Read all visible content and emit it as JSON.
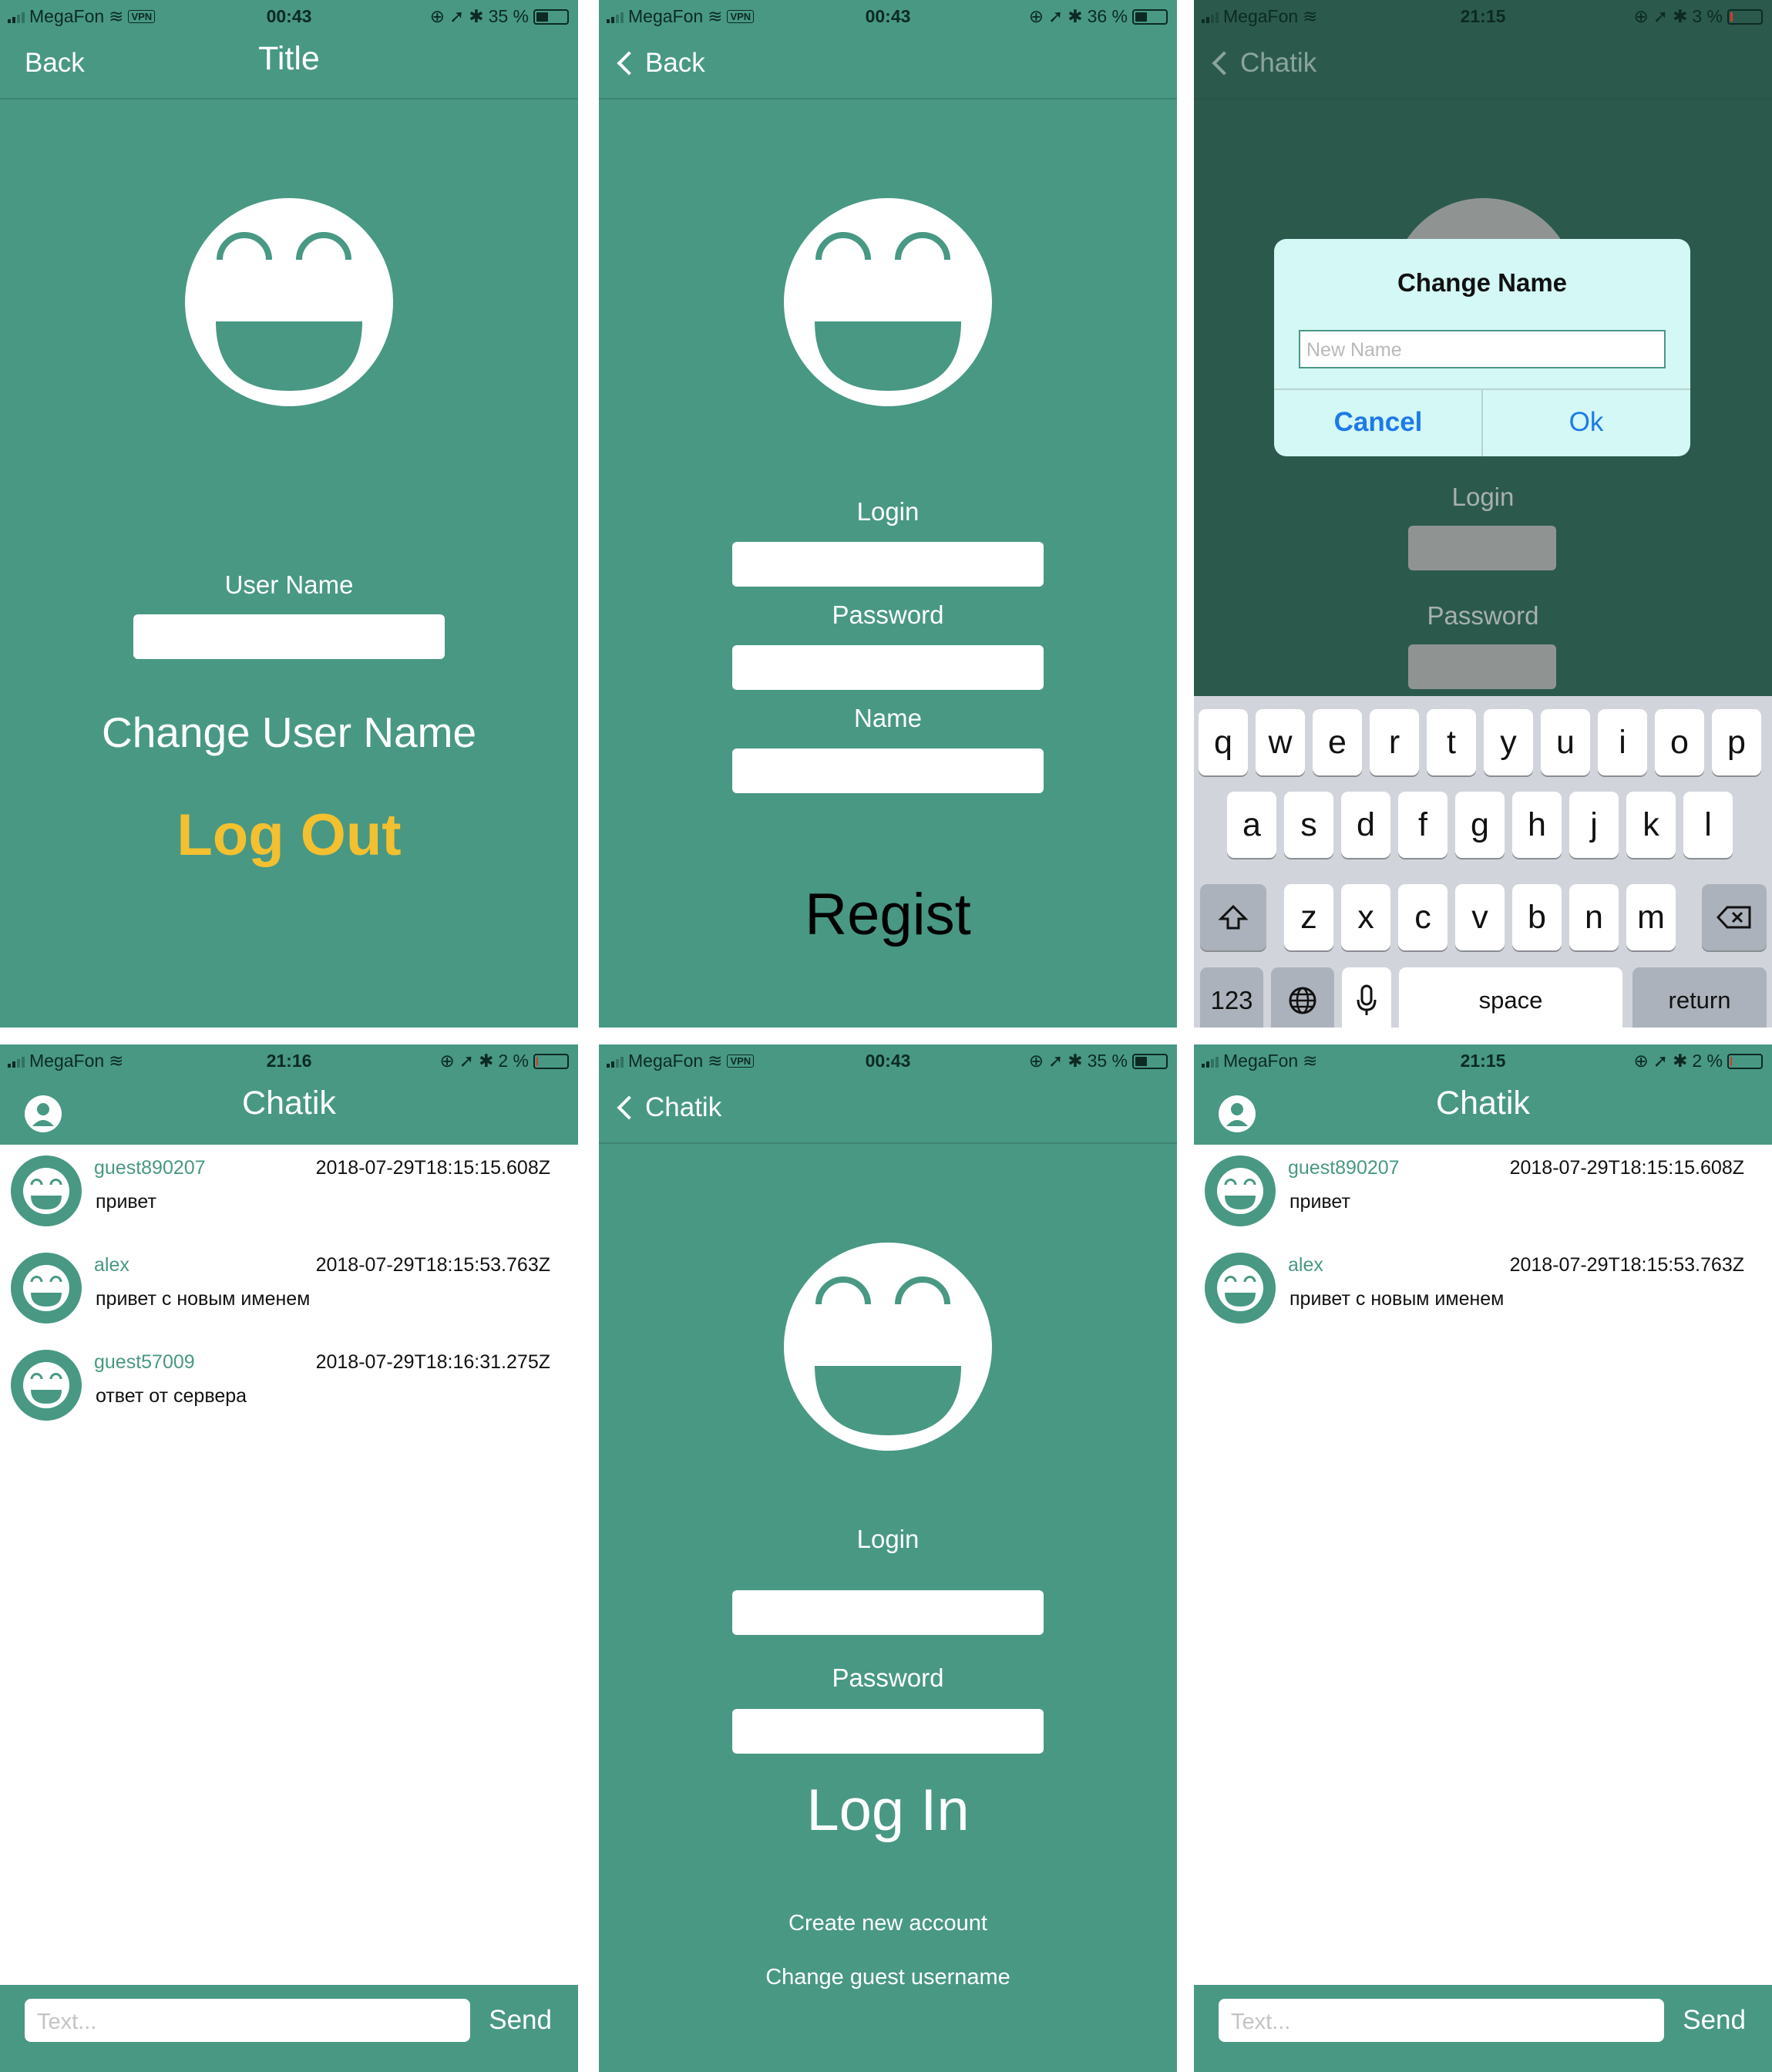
{
  "status_bars": [
    {
      "carrier": "MegaFon",
      "time": "00:43",
      "battery": "35 %",
      "vpn": "VPN",
      "battery_level": 0.35
    },
    {
      "carrier": "MegaFon",
      "time": "00:43",
      "battery": "36 %",
      "vpn": "VPN",
      "battery_level": 0.36
    },
    {
      "carrier": "MegaFon",
      "time": "21:15",
      "battery": "3 %",
      "battery_level": 0.03
    },
    {
      "carrier": "MegaFon",
      "time": "21:16",
      "battery": "2 %",
      "battery_level": 0.02
    },
    {
      "carrier": "MegaFon",
      "time": "00:43",
      "battery": "35 %",
      "vpn": "VPN",
      "battery_level": 0.35
    },
    {
      "carrier": "MegaFon",
      "time": "21:15",
      "battery": "2 %",
      "battery_level": 0.02
    }
  ],
  "profile": {
    "back": "Back",
    "title": "Title",
    "username_label": "User Name",
    "change_username": "Change User Name",
    "logout": "Log Out"
  },
  "register": {
    "back": "Back",
    "login_label": "Login",
    "password_label": "Password",
    "name_label": "Name",
    "regist": "Regist"
  },
  "change_name": {
    "back": "Chatik",
    "title": "Change Name",
    "placeholder": "New Name",
    "cancel": "Cancel",
    "ok": "Ok",
    "login_label": "Login",
    "password_label": "Password"
  },
  "keyboard": {
    "row1": [
      "q",
      "w",
      "e",
      "r",
      "t",
      "y",
      "u",
      "i",
      "o",
      "p"
    ],
    "row2": [
      "a",
      "s",
      "d",
      "f",
      "g",
      "h",
      "j",
      "k",
      "l"
    ],
    "row3": [
      "z",
      "x",
      "c",
      "v",
      "b",
      "n",
      "m"
    ],
    "numbers": "123",
    "space": "space",
    "return": "return"
  },
  "chat1": {
    "title": "Chatik",
    "messages": [
      {
        "name": "guest890207",
        "time": "2018-07-29T18:15:15.608Z",
        "text": "привет"
      },
      {
        "name": "alex",
        "time": "2018-07-29T18:15:53.763Z",
        "text": "привет с новым именем"
      },
      {
        "name": "guest57009",
        "time": "2018-07-29T18:16:31.275Z",
        "text": "ответ от сервера"
      }
    ],
    "placeholder": "Text...",
    "send": "Send"
  },
  "login": {
    "back": "Chatik",
    "login_label": "Login",
    "password_label": "Password",
    "login_button": "Log In",
    "create_account": "Create new account",
    "change_guest": "Change guest username"
  },
  "chat2": {
    "title": "Chatik",
    "messages": [
      {
        "name": "guest890207",
        "time": "2018-07-29T18:15:15.608Z",
        "text": "привет"
      },
      {
        "name": "alex",
        "time": "2018-07-29T18:15:53.763Z",
        "text": "привет с новым именем"
      }
    ],
    "placeholder": "Text...",
    "send": "Send"
  },
  "colors": {
    "accent": "#489884",
    "logout": "#f3c030",
    "link": "#1e7ae8",
    "dialog_bg": "#d3f8f5"
  }
}
